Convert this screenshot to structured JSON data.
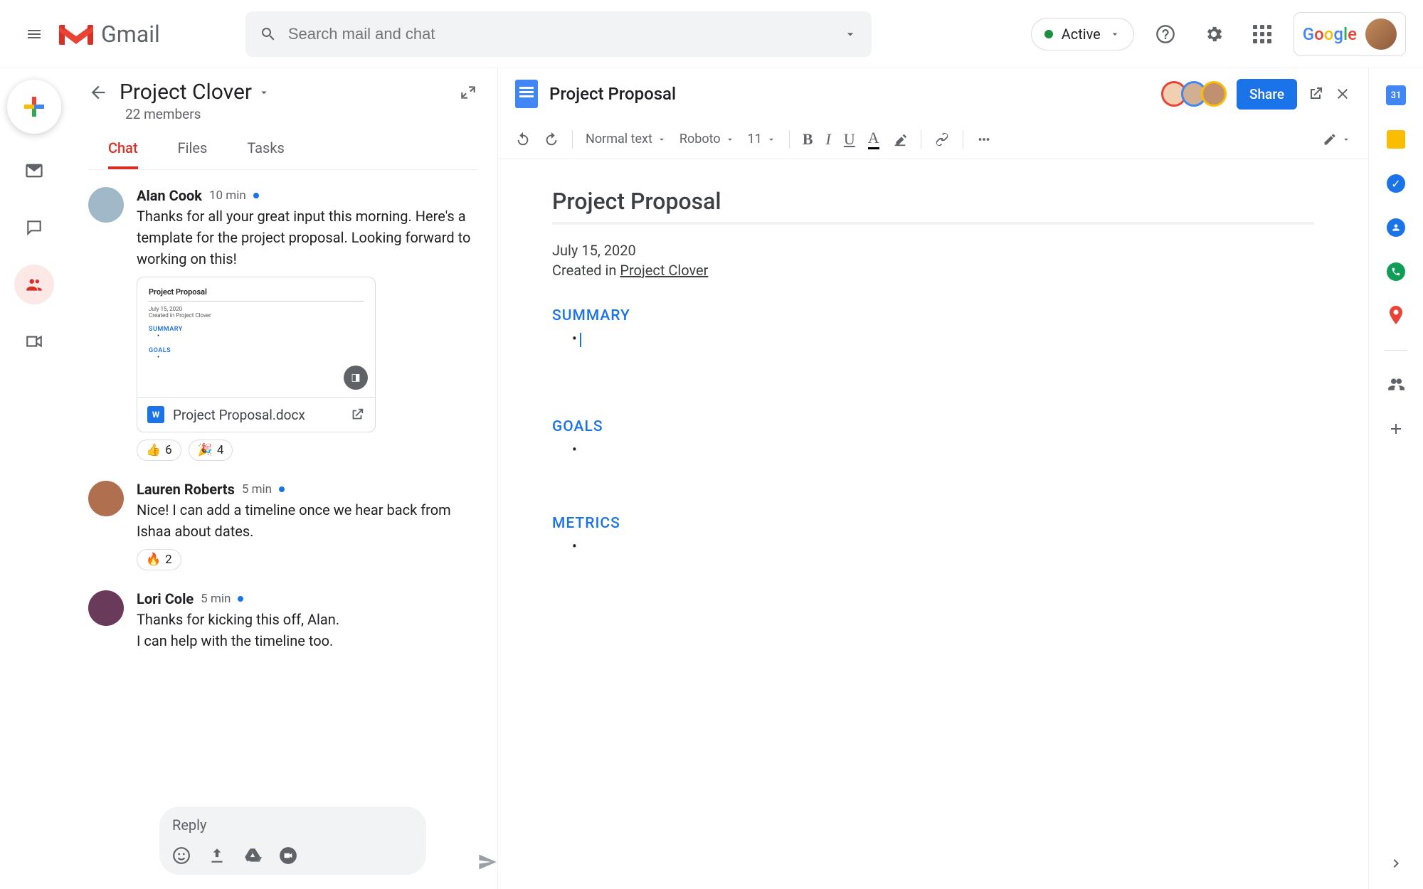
{
  "app_name": "Gmail",
  "search": {
    "placeholder": "Search mail and chat"
  },
  "status": {
    "label": "Active"
  },
  "google_logo": [
    "G",
    "o",
    "o",
    "g",
    "l",
    "e"
  ],
  "chat": {
    "title": "Project Clover",
    "members": "22 members",
    "tabs": [
      "Chat",
      "Files",
      "Tasks"
    ],
    "active_tab": 0,
    "reply_placeholder": "Reply"
  },
  "messages": [
    {
      "author": "Alan Cook",
      "time": "10 min",
      "unread": true,
      "text": "Thanks for all your great input this morning. Here's a template for the project proposal. Looking forward to working on this!",
      "avatar_color": "#a0b8c8",
      "attachment": {
        "filename": "Project Proposal.docx",
        "preview_title": "Project Proposal",
        "preview_date": "July 15, 2020",
        "preview_created": "Created in Project Clover",
        "preview_sections": [
          "SUMMARY",
          "GOALS"
        ]
      },
      "reactions": [
        {
          "emoji": "👍",
          "count": "6"
        },
        {
          "emoji": "🎉",
          "count": "4"
        }
      ]
    },
    {
      "author": "Lauren Roberts",
      "time": "5 min",
      "unread": true,
      "text": "Nice! I can add a timeline once we hear back from Ishaa about dates.",
      "avatar_color": "#b07050",
      "reactions": [
        {
          "emoji": "🔥",
          "count": "2"
        }
      ]
    },
    {
      "author": "Lori Cole",
      "time": "5 min",
      "unread": true,
      "text": "Thanks for kicking this off, Alan.\nI can help with the timeline too.",
      "avatar_color": "#6a3a5a",
      "reactions": []
    }
  ],
  "doc": {
    "title": "Project Proposal",
    "share_label": "Share",
    "toolbar": {
      "style": "Normal text",
      "font": "Roboto",
      "size": "11"
    },
    "body": {
      "heading": "Project Proposal",
      "date": "July 15, 2020",
      "created_prefix": "Created in ",
      "created_link": "Project Clover",
      "sections": [
        "SUMMARY",
        "GOALS",
        "METRICS"
      ]
    }
  },
  "side_cal_day": "31"
}
